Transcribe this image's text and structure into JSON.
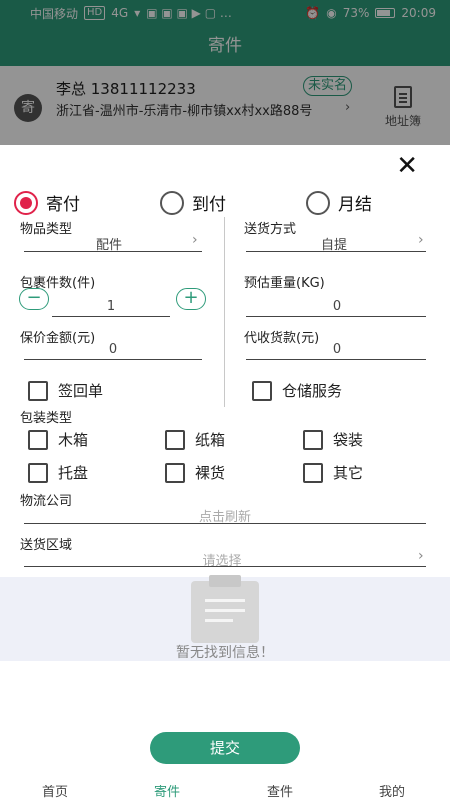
{
  "status_bar": {
    "carrier": "中国移动",
    "hd_badge": "HD",
    "signal": "4G",
    "battery_percent": "73%",
    "time": "20:09"
  },
  "header": {
    "title": "寄件"
  },
  "sender": {
    "avatar_label": "寄",
    "name_phone": "李总 13811112233",
    "badge": "未实名",
    "address": "浙江省-温州市-乐清市-柳市镇xx村xx路88号",
    "address_book_label": "地址簿"
  },
  "payment": {
    "options": [
      "寄付",
      "到付",
      "月结"
    ],
    "selected": "寄付"
  },
  "form": {
    "item_type_label": "物品类型",
    "item_type_value": "配件",
    "delivery_method_label": "送货方式",
    "delivery_method_value": "自提",
    "package_count_label": "包裹件数(件)",
    "package_count_value": "1",
    "minus_label": "−",
    "plus_label": "+",
    "weight_label": "预估重量(KG)",
    "weight_value": "0",
    "insured_label": "保价金额(元)",
    "insured_value": "0",
    "cod_label": "代收货款(元)",
    "cod_value": "0",
    "receipt_label": "签回单",
    "warehouse_label": "仓储服务",
    "packaging_label": "包装类型",
    "packaging_options": [
      "木箱",
      "纸箱",
      "袋装",
      "托盘",
      "裸货",
      "其它"
    ],
    "logistics_label": "物流公司",
    "logistics_value": "点击刷新",
    "area_label": "送货区域",
    "area_placeholder": "请选择"
  },
  "empty_state": {
    "text": "暂无找到信息！"
  },
  "submit_label": "提交",
  "bottom_nav": {
    "items": [
      "首页",
      "寄件",
      "查件",
      "我的"
    ],
    "active": "寄件"
  },
  "colors": {
    "primary": "#2e9b7a",
    "radio_checked": "#e0224a"
  }
}
